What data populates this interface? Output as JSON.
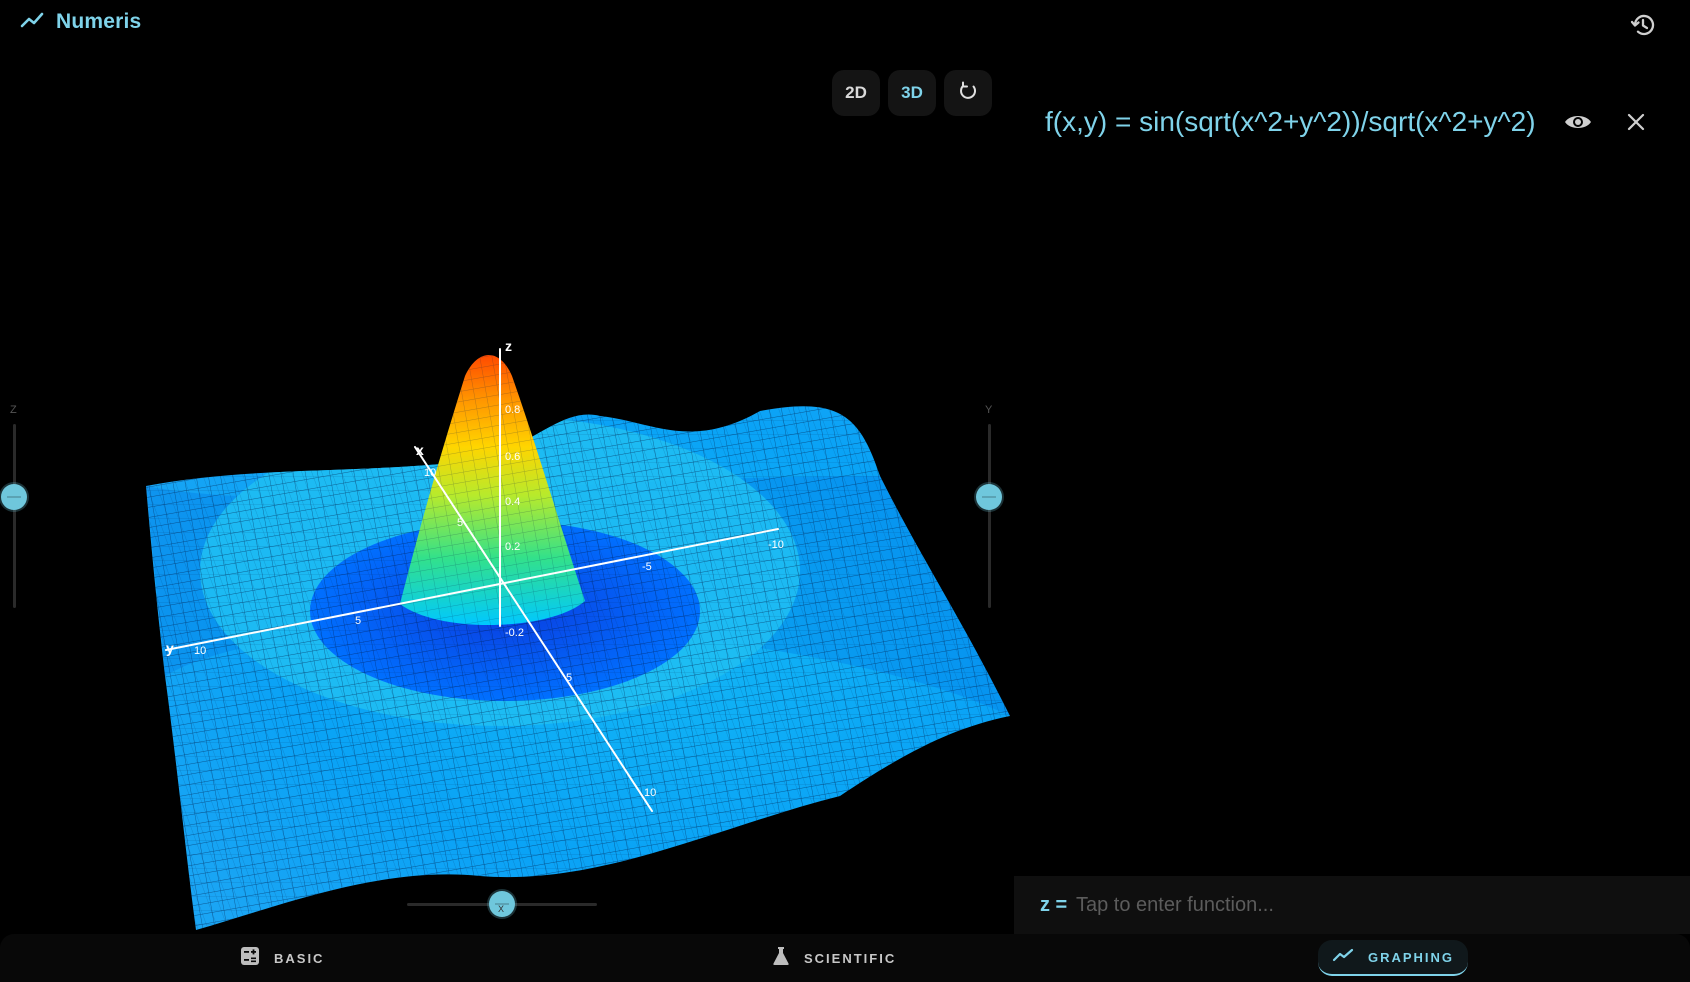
{
  "app": {
    "title": "Numeris"
  },
  "graph_controls": {
    "mode_2d": "2D",
    "mode_3d": "3D",
    "active_mode": "3D",
    "reset_icon": "rotate-icon",
    "history_icon": "history-icon"
  },
  "sliders": {
    "left_label": "Z",
    "right_label": "Y",
    "bottom_label": "X"
  },
  "plot": {
    "axis_x_label": "x",
    "axis_y_label": "y",
    "axis_z_label": "z",
    "z_ticks": [
      "0.8",
      "0.6",
      "0.4",
      "0.2",
      "-0.2"
    ],
    "x_ticks": [
      "10",
      "5",
      "5",
      "10"
    ],
    "y_ticks": [
      "10",
      "5",
      "-5",
      "-10"
    ]
  },
  "function": {
    "expression": "f(x,y) = sin(sqrt(x^2+y^2))/sqrt(x^2+y^2)",
    "visibility_icon": "eye-icon",
    "close_icon": "close-icon"
  },
  "input": {
    "prefix": "z =",
    "placeholder": "Tap to enter function..."
  },
  "nav": {
    "basic": "BASIC",
    "scientific": "SCIENTIFIC",
    "graphing": "GRAPHING",
    "active": "GRAPHING"
  },
  "colors": {
    "accent": "#7fd3ea",
    "background": "#000000",
    "surface_low": "#00a7ff",
    "surface_high": "#ff4a00"
  }
}
